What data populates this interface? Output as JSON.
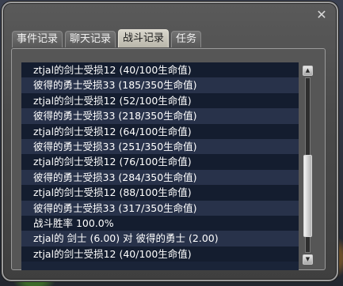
{
  "window": {
    "close_glyph": "✕"
  },
  "tabs": [
    {
      "label": "事件记录",
      "active": false
    },
    {
      "label": "聊天记录",
      "active": false
    },
    {
      "label": "战斗记录",
      "active": true
    },
    {
      "label": "任务",
      "active": false
    }
  ],
  "log_rows": [
    "ztjal的剑士受损12 (40/100生命值)",
    "彼得的勇士受损33 (185/350生命值)",
    "ztjal的剑士受损12 (52/100生命值)",
    "彼得的勇士受损33 (218/350生命值)",
    "ztjal的剑士受损12 (64/100生命值)",
    "彼得的勇士受损33 (251/350生命值)",
    "ztjal的剑士受损12 (76/100生命值)",
    "彼得的勇士受损33 (284/350生命值)",
    "ztjal的剑士受损12 (88/100生命值)",
    "彼得的勇士受损33 (317/350生命值)",
    "战斗胜率 100.0%",
    "ztjal的 剑士 (6.00) 对 彼得的勇士 (2.00)",
    "ztjal的剑士受损12 (40/100生命值)"
  ],
  "scrollbar": {
    "up_glyph": "▲",
    "down_glyph": "▼"
  }
}
